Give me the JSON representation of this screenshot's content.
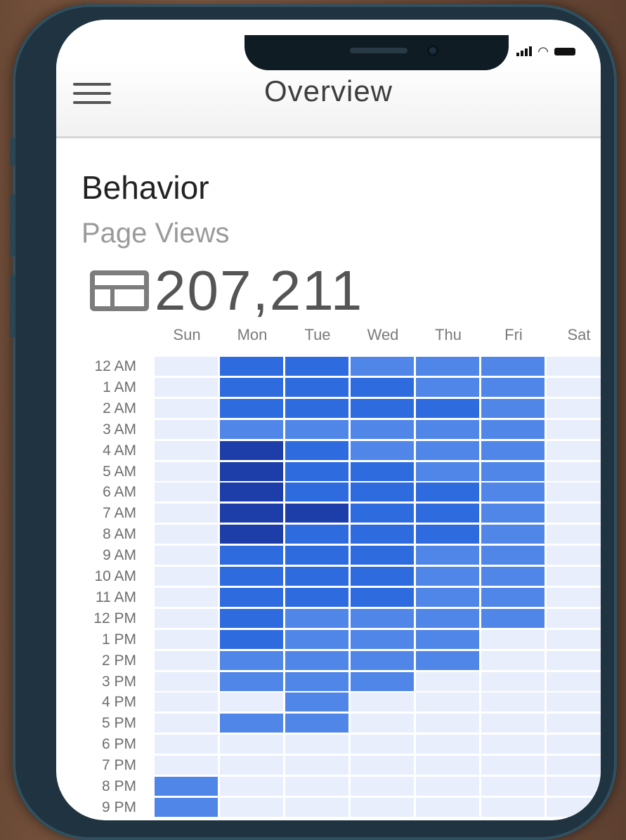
{
  "header": {
    "title": "Overview"
  },
  "section": {
    "title": "Behavior",
    "subtitle": "Page Views"
  },
  "metric": {
    "value": "207,211",
    "icon": "table-layout-icon"
  },
  "icons": [
    "hamburger-menu-icon",
    "signal-icon",
    "wifi-icon",
    "battery-icon",
    "table-layout-icon"
  ],
  "chart_data": {
    "type": "heatmap",
    "title": "",
    "x_categories": [
      "Sun",
      "Mon",
      "Tue",
      "Wed",
      "Thu",
      "Fri",
      "Sat"
    ],
    "y_categories": [
      "12 AM",
      "1 AM",
      "2 AM",
      "3 AM",
      "4 AM",
      "5 AM",
      "6 AM",
      "7 AM",
      "8 AM",
      "9 AM",
      "10 AM",
      "11 AM",
      "12 PM",
      "1 PM",
      "2 PM",
      "3 PM",
      "4 PM",
      "5 PM",
      "6 PM",
      "7 PM",
      "8 PM",
      "9 PM"
    ],
    "intensity_scale": "0 = lightest, 4 = darkest",
    "colors": [
      "#e8eefb",
      "#82acf2",
      "#4f86e8",
      "#2e6bdf",
      "#1d3ea8"
    ],
    "values": [
      [
        0,
        3,
        3,
        2,
        2,
        2,
        0
      ],
      [
        0,
        3,
        3,
        3,
        2,
        2,
        0
      ],
      [
        0,
        3,
        3,
        3,
        3,
        2,
        0
      ],
      [
        0,
        2,
        2,
        2,
        2,
        2,
        0
      ],
      [
        0,
        4,
        3,
        2,
        2,
        2,
        0
      ],
      [
        0,
        4,
        3,
        3,
        2,
        2,
        0
      ],
      [
        0,
        4,
        3,
        3,
        3,
        2,
        0
      ],
      [
        0,
        4,
        4,
        3,
        3,
        2,
        0
      ],
      [
        0,
        4,
        3,
        3,
        3,
        2,
        0
      ],
      [
        0,
        3,
        3,
        3,
        2,
        2,
        0
      ],
      [
        0,
        3,
        3,
        3,
        2,
        2,
        0
      ],
      [
        0,
        3,
        3,
        3,
        2,
        2,
        0
      ],
      [
        0,
        3,
        2,
        2,
        2,
        2,
        0
      ],
      [
        0,
        3,
        2,
        2,
        2,
        0,
        0
      ],
      [
        0,
        2,
        2,
        2,
        2,
        0,
        0
      ],
      [
        0,
        2,
        2,
        2,
        0,
        0,
        0
      ],
      [
        0,
        0,
        2,
        0,
        0,
        0,
        0
      ],
      [
        0,
        2,
        2,
        0,
        0,
        0,
        0
      ],
      [
        0,
        0,
        0,
        0,
        0,
        0,
        0
      ],
      [
        0,
        0,
        0,
        0,
        0,
        0,
        0
      ],
      [
        2,
        0,
        0,
        0,
        0,
        0,
        0
      ],
      [
        2,
        0,
        0,
        0,
        0,
        0,
        0
      ]
    ]
  }
}
